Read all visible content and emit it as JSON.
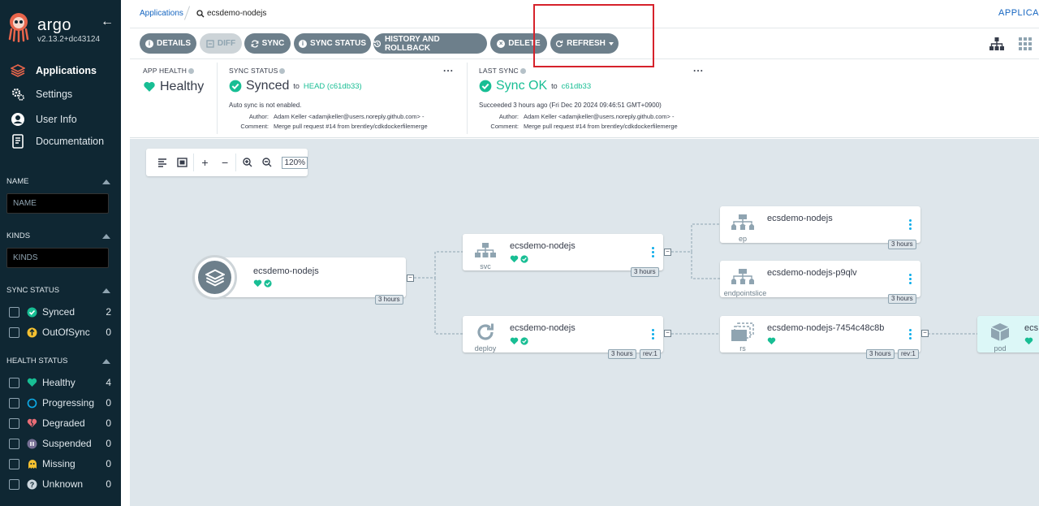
{
  "sidebar": {
    "brand": "argo",
    "version": "v2.13.2+dc43124",
    "nav": [
      {
        "label": "Applications",
        "icon": "layers-icon"
      },
      {
        "label": "Settings",
        "icon": "gears-icon"
      },
      {
        "label": "User Info",
        "icon": "user-icon"
      },
      {
        "label": "Documentation",
        "icon": "book-icon"
      }
    ],
    "name_header": "NAME",
    "name_placeholder": "NAME",
    "kinds_header": "KINDS",
    "kinds_placeholder": "KINDS",
    "sync_header": "SYNC STATUS",
    "sync_filters": [
      {
        "label": "Synced",
        "count": "2",
        "color": "#18be94"
      },
      {
        "label": "OutOfSync",
        "count": "0",
        "color": "#f4c030"
      }
    ],
    "health_header": "HEALTH STATUS",
    "health_filters": [
      {
        "label": "Healthy",
        "count": "4",
        "color": "#18be94"
      },
      {
        "label": "Progressing",
        "count": "0",
        "color": "#0dadea"
      },
      {
        "label": "Degraded",
        "count": "0",
        "color": "#e96d76"
      },
      {
        "label": "Suspended",
        "count": "0",
        "color": "#766f94"
      },
      {
        "label": "Missing",
        "count": "0",
        "color": "#f4c030"
      },
      {
        "label": "Unknown",
        "count": "0",
        "color": "#ccd6dd"
      }
    ]
  },
  "topbar": {
    "breadcrumb": "Applications",
    "current": "ecsdemo-nodejs",
    "right_label": "APPLICA"
  },
  "toolbar": {
    "details": "DETAILS",
    "diff": "DIFF",
    "sync": "SYNC",
    "sync_status": "SYNC STATUS",
    "history": "HISTORY AND ROLLBACK",
    "delete": "DELETE",
    "refresh": "REFRESH"
  },
  "status": {
    "app_health_label": "APP HEALTH",
    "app_health_value": "Healthy",
    "sync_status_label": "SYNC STATUS",
    "sync_status_value": "Synced",
    "sync_to": "to",
    "sync_target": "HEAD (c61db33)",
    "auto_sync": "Auto sync is not enabled.",
    "author_key": "Author:",
    "author_val": "Adam Keller <adamjkeller@users.noreply.github.com> -",
    "comment_key": "Comment:",
    "comment_val": "Merge pull request #14 from brentley/cdkdockerfilemerge",
    "last_sync_label": "LAST SYNC",
    "last_sync_value": "Sync OK",
    "last_sync_to": "to",
    "last_sync_target": "c61db33",
    "succeeded": "Succeeded 3 hours ago (Fri Dec 20 2024 09:46:51 GMT+0900)",
    "more": "..."
  },
  "graph": {
    "zoom": "120%",
    "app": {
      "title": "ecsdemo-nodejs",
      "age": "3 hours"
    },
    "nodes": {
      "svc": {
        "title": "ecsdemo-nodejs",
        "kind": "svc",
        "age": "3 hours"
      },
      "deploy": {
        "title": "ecsdemo-nodejs",
        "kind": "deploy",
        "age": "3 hours",
        "rev": "rev:1"
      },
      "ep": {
        "title": "ecsdemo-nodejs",
        "kind": "ep",
        "age": "3 hours"
      },
      "eps": {
        "title": "ecsdemo-nodejs-p9qlv",
        "kind": "endpointslice",
        "age": "3 hours"
      },
      "rs": {
        "title": "ecsdemo-nodejs-7454c48c8b",
        "kind": "rs",
        "age": "3 hours",
        "rev": "rev:1"
      },
      "pod": {
        "title": "ecs",
        "kind": "pod"
      }
    },
    "collapse_symbol": "−"
  },
  "colors": {
    "sidebar_bg": "#0f2733",
    "healthy": "#18be94",
    "graph_bg": "#dee6eb",
    "button": "#6d7f8b"
  }
}
